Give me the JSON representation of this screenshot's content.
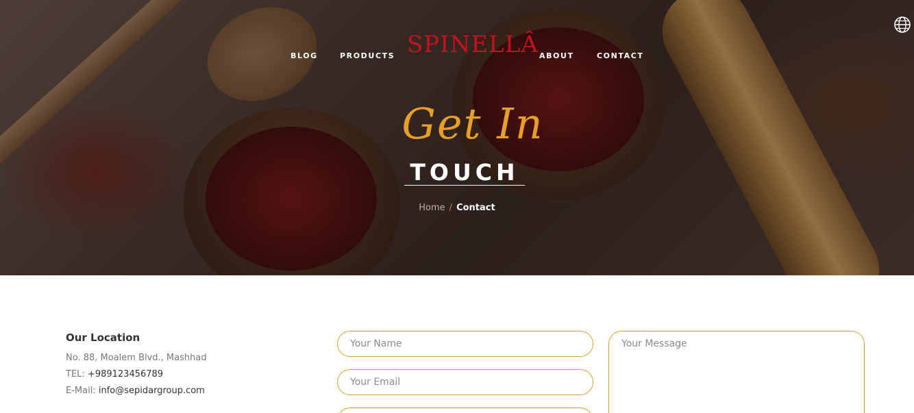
{
  "nav": {
    "left_items": [
      "BLOG",
      "PRODUCTS"
    ],
    "right_items": [
      "ABOUT",
      "CONTACT"
    ],
    "logo": "SPINELLÂ",
    "globe_icon": "globe-icon"
  },
  "hero": {
    "script_title": "Get In",
    "title": "TOUCH",
    "breadcrumb": {
      "home": "Home",
      "separator": "/",
      "current": "Contact"
    }
  },
  "location": {
    "title": "Our Location",
    "address": "No. 88, Moalem Blvd., Mashhad",
    "tel_label": "TEL:",
    "tel_value": "+989123456789",
    "email_label": "E-Mail:",
    "email_value": "info@sepidargroup.com"
  },
  "form": {
    "name_placeholder": "Your Name",
    "email_placeholder": "Your Email",
    "message_placeholder": "Your Message"
  },
  "colors": {
    "accent": "#d8a12e",
    "brand": "#c4131e",
    "script": "#e6a029"
  }
}
